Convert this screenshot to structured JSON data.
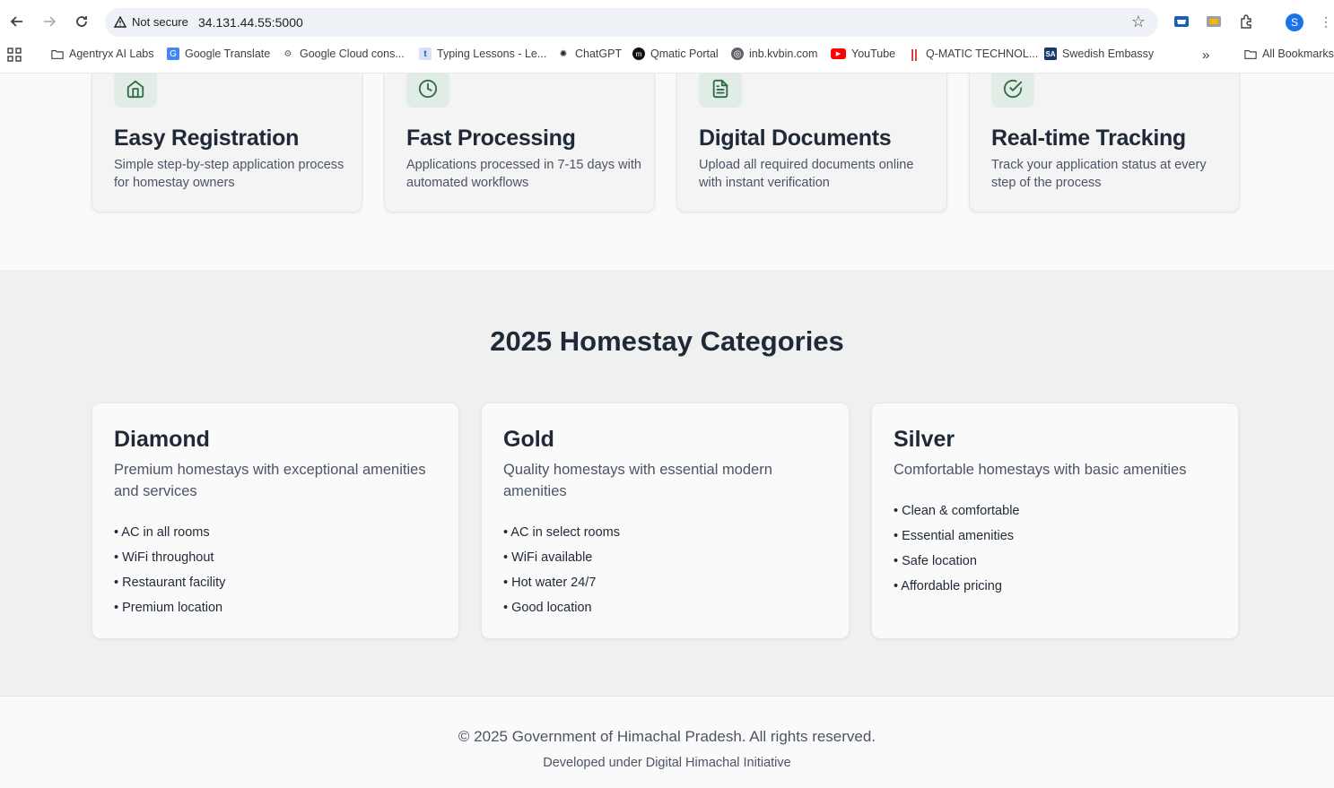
{
  "browser": {
    "security_label": "Not secure",
    "url": "34.131.44.55:5000",
    "profile_initial": "S",
    "bookmarks": [
      {
        "label": "Agentryx AI Labs",
        "icon": "folder-icon"
      },
      {
        "label": "Google Translate",
        "icon": "translate-icon"
      },
      {
        "label": "Google Cloud cons...",
        "icon": "cloud-icon"
      },
      {
        "label": "Typing Lessons - Le...",
        "icon": "typing-icon"
      },
      {
        "label": "ChatGPT",
        "icon": "chatgpt-icon"
      },
      {
        "label": "Qmatic Portal",
        "icon": "qmatic-icon"
      },
      {
        "label": "inb.kvbin.com",
        "icon": "globe-icon"
      },
      {
        "label": "YouTube",
        "icon": "youtube-icon"
      },
      {
        "label": "Q-MATIC TECHNOL...",
        "icon": "qmatic-tech-icon"
      },
      {
        "label": "Swedish Embassy",
        "icon": "sa-icon"
      }
    ],
    "all_bookmarks_label": "All Bookmarks"
  },
  "features": [
    {
      "title": "Easy Registration",
      "desc": "Simple step-by-step application process for homestay owners",
      "icon": "home-icon"
    },
    {
      "title": "Fast Processing",
      "desc": "Applications processed in 7-15 days with automated workflows",
      "icon": "clock-icon"
    },
    {
      "title": "Digital Documents",
      "desc": "Upload all required documents online with instant verification",
      "icon": "document-icon"
    },
    {
      "title": "Real-time Tracking",
      "desc": "Track your application status at every step of the process",
      "icon": "check-circle-icon"
    }
  ],
  "categories_section": {
    "title": "2025 Homestay Categories",
    "cards": [
      {
        "name": "Diamond",
        "desc": "Premium homestays with exceptional amenities and services",
        "items": [
          "• AC in all rooms",
          "• WiFi throughout",
          "• Restaurant facility",
          "• Premium location"
        ]
      },
      {
        "name": "Gold",
        "desc": "Quality homestays with essential modern amenities",
        "items": [
          "• AC in select rooms",
          "• WiFi available",
          "• Hot water 24/7",
          "• Good location"
        ]
      },
      {
        "name": "Silver",
        "desc": "Comfortable homestays with basic amenities",
        "items": [
          "• Clean & comfortable",
          "• Essential amenities",
          "• Safe location",
          "• Affordable pricing"
        ]
      }
    ]
  },
  "footer": {
    "copyright": "© 2025 Government of Himachal Pradesh. All rights reserved.",
    "developed": "Developed under Digital Himachal Initiative"
  },
  "colors": {
    "accent": "#2f6b47",
    "icon_bg": "#e2ece6",
    "section_bg": "#eef1f0"
  }
}
